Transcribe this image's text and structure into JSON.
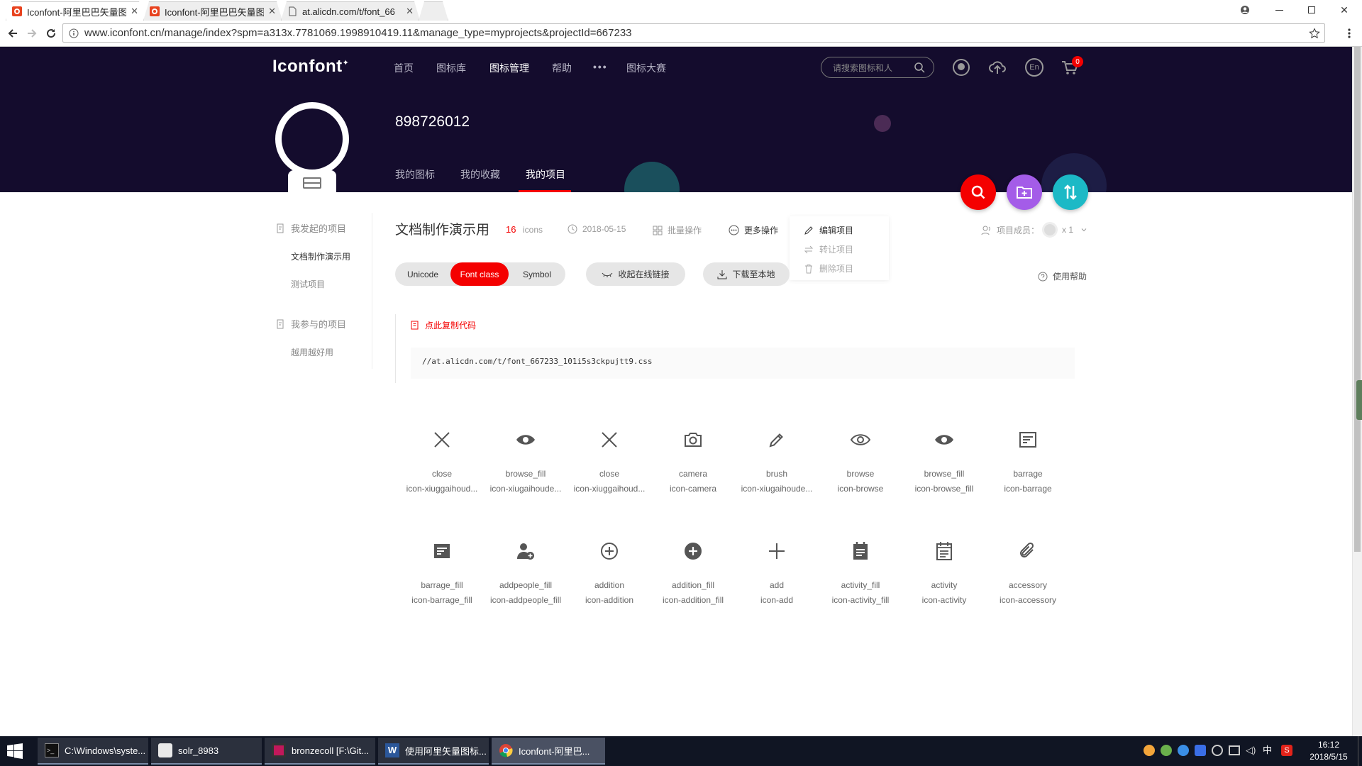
{
  "browser": {
    "tabs": [
      {
        "title": "Iconfont-阿里巴巴矢量图"
      },
      {
        "title": "Iconfont-阿里巴巴矢量图"
      },
      {
        "title": "at.alicdn.com/t/font_66"
      }
    ],
    "url": "www.iconfont.cn/manage/index?spm=a313x.7781069.1998910419.11&manage_type=myprojects&projectId=667233"
  },
  "site": {
    "logo": "Iconfont",
    "nav": [
      "首页",
      "图标库",
      "图标管理",
      "帮助",
      "图标大赛"
    ],
    "nav_more": "•••",
    "search_placeholder": "请搜索图标和人",
    "cart_count": "0",
    "lang_icon_text": "En",
    "username": "898726012",
    "subnav": [
      "我的图标",
      "我的收藏",
      "我的项目"
    ]
  },
  "sidebar": {
    "started_title": "我发起的项目",
    "started_items": [
      "文档制作演示用",
      "测试项目"
    ],
    "joined_title": "我参与的项目",
    "joined_items": [
      "越用越好用"
    ]
  },
  "project": {
    "title": "文档制作演示用",
    "count": "16",
    "count_unit": "icons",
    "date": "2018-05-15",
    "batch": "批量操作",
    "more": "更多操作",
    "menu": [
      "编辑项目",
      "转让项目",
      "删除项目"
    ],
    "members_label": "项目成员：",
    "members_count": "x 1",
    "help": "使用帮助",
    "tabs": [
      "Unicode",
      "Font class",
      "Symbol"
    ],
    "collapse_btn": "收起在线链接",
    "download_btn": "下载至本地",
    "copy_label": "点此复制代码",
    "css_url": "//at.alicdn.com/t/font_667233_101i5s3ckpujtt9.css"
  },
  "icons": [
    {
      "name": "close",
      "code": "icon-xiuggaihoud...",
      "icon": "close-icon"
    },
    {
      "name": "browse_fill",
      "code": "icon-xiugaihoude...",
      "icon": "browse-fill-icon"
    },
    {
      "name": "close",
      "code": "icon-xiuggaihoud...",
      "icon": "close-icon"
    },
    {
      "name": "camera",
      "code": "icon-camera",
      "icon": "camera-icon"
    },
    {
      "name": "brush",
      "code": "icon-xiugaihoude...",
      "icon": "brush-icon"
    },
    {
      "name": "browse",
      "code": "icon-browse",
      "icon": "browse-icon"
    },
    {
      "name": "browse_fill",
      "code": "icon-browse_fill",
      "icon": "browse-fill-icon"
    },
    {
      "name": "barrage",
      "code": "icon-barrage",
      "icon": "barrage-icon"
    },
    {
      "name": "barrage_fill",
      "code": "icon-barrage_fill",
      "icon": "barrage-fill-icon"
    },
    {
      "name": "addpeople_fill",
      "code": "icon-addpeople_fill",
      "icon": "addpeople-fill-icon"
    },
    {
      "name": "addition",
      "code": "icon-addition",
      "icon": "addition-icon"
    },
    {
      "name": "addition_fill",
      "code": "icon-addition_fill",
      "icon": "addition-fill-icon"
    },
    {
      "name": "add",
      "code": "icon-add",
      "icon": "add-icon"
    },
    {
      "name": "activity_fill",
      "code": "icon-activity_fill",
      "icon": "activity-fill-icon"
    },
    {
      "name": "activity",
      "code": "icon-activity",
      "icon": "activity-icon"
    },
    {
      "name": "accessory",
      "code": "icon-accessory",
      "icon": "accessory-icon"
    }
  ],
  "taskbar": {
    "items": [
      "C:\\Windows\\syste...",
      "solr_8983",
      "bronzecoll [F:\\Git...",
      "使用阿里矢量图标...",
      "Iconfont-阿里巴..."
    ],
    "time": "16:12",
    "date": "2018/5/15",
    "ime": "中"
  },
  "colors": {
    "brand_red": "#f40000",
    "header_bg": "#140c2d",
    "fab_purple": "#a45ce8",
    "fab_teal": "#1cb9c6"
  }
}
